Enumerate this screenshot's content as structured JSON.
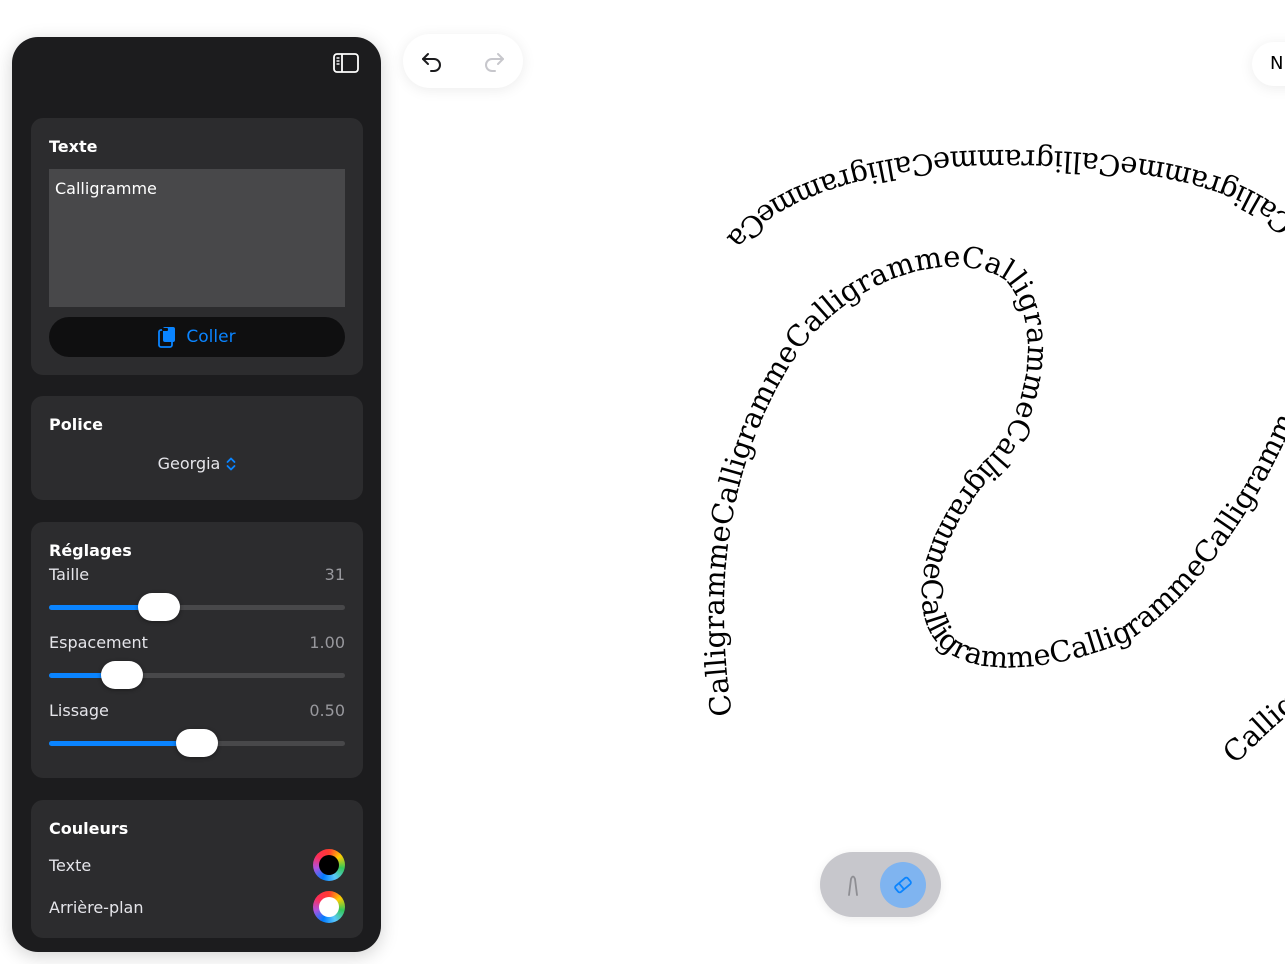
{
  "panel": {
    "text_section": {
      "title": "Texte",
      "value": "Calligramme",
      "paste_label": "Coller"
    },
    "font_section": {
      "title": "Police",
      "selected": "Georgia"
    },
    "settings_section": {
      "title": "Réglages",
      "size": {
        "label": "Taille",
        "value": "31",
        "fraction": 0.37
      },
      "spacing": {
        "label": "Espacement",
        "value": "1.00",
        "fraction": 0.245
      },
      "smoothing": {
        "label": "Lissage",
        "value": "0.50",
        "fraction": 0.5
      }
    },
    "colors_section": {
      "title": "Couleurs",
      "text_label": "Texte",
      "text_color": "#000000",
      "background_label": "Arrière-plan",
      "background_color": "#ffffff"
    }
  },
  "toolbar": {
    "top_right_label": "N"
  },
  "canvas": {
    "path_text": "Calligramme",
    "text_color": "#000000"
  },
  "colors": {
    "accent": "#0a84ff",
    "panel_bg": "#1c1c1e",
    "card_bg": "#2c2c2e"
  },
  "icons": [
    "sidebar-icon",
    "undo-icon",
    "redo-icon",
    "paste-icon",
    "chevron-updown-icon",
    "pen-icon",
    "eraser-icon"
  ]
}
